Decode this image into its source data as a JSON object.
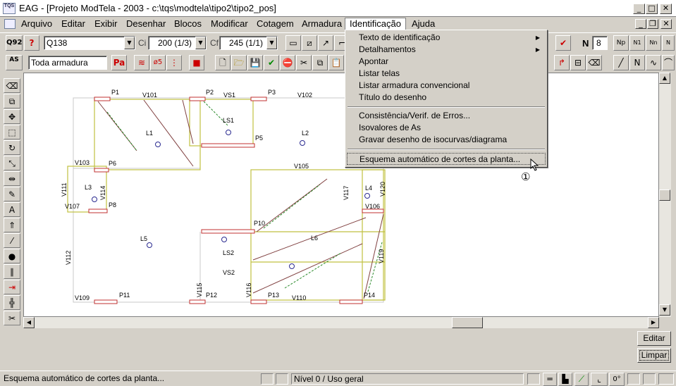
{
  "window": {
    "title": "EAG - [Projeto ModTela - 2003 - c:\\tqs\\modtela\\tipo2\\tipo2_pos]",
    "app_icon": "TQS"
  },
  "menubar": {
    "items": [
      "Arquivo",
      "Editar",
      "Exibir",
      "Desenhar",
      "Blocos",
      "Modificar",
      "Cotagem",
      "Armadura",
      "Identificação",
      "Ajuda"
    ],
    "active": "Identificação"
  },
  "toolbar1": {
    "q92_label": "Q92",
    "bar_combo": "Q138",
    "ci_label": "Ci",
    "ci_value": "200 (1/3)",
    "cf_label": "Cf",
    "cf_value": "245 (1/1)",
    "n_label": "N",
    "n_value": "8"
  },
  "toolbar2": {
    "as_label": "AS",
    "filter_value": "Toda armadura",
    "pa_label": "Pa",
    "o5_label": "ø5"
  },
  "dropdown_menu": {
    "items": [
      {
        "label": "Texto de identificação",
        "submenu": true
      },
      {
        "label": "Detalhamentos",
        "submenu": true
      },
      {
        "label": "Apontar"
      },
      {
        "label": "Listar telas"
      },
      {
        "label": "Listar armadura convencional"
      },
      {
        "label": "Título do desenho"
      },
      {
        "label": "Consistência/Verif. de Erros..."
      },
      {
        "label": "Isovalores de As"
      },
      {
        "label": "Gravar desenho de isocurvas/diagrama"
      },
      {
        "label": "Esquema automático de cortes da planta..."
      }
    ],
    "highlighted": "Esquema automático de cortes da planta...",
    "callout": "①"
  },
  "drawing": {
    "labels": {
      "P1": "P1",
      "P2": "P2",
      "P3": "P3",
      "P5": "P5",
      "P6": "P6",
      "P8": "P8",
      "P10": "P10",
      "P11": "P11",
      "P12": "P12",
      "P13": "P13",
      "P14": "P14",
      "V101": "V101",
      "VS1": "VS1",
      "V102": "V102",
      "V103": "V103",
      "V105": "V105",
      "V106": "V106",
      "V107": "V107",
      "V109": "V109",
      "V110": "V110",
      "V111": "V111",
      "V112": "V112",
      "V114": "V114",
      "V115": "V115",
      "V116": "V116",
      "V117": "V117",
      "V119": "V119",
      "V120": "V120",
      "VS2": "VS2",
      "L1": "L1",
      "L2": "L2",
      "L3": "L3",
      "L4": "L4",
      "L5": "L5",
      "L6": "L6",
      "LS1": "LS1",
      "LS2": "LS2"
    }
  },
  "side_buttons": {
    "edit": "Editar",
    "clear": "Limpar"
  },
  "statusbar": {
    "message": "Esquema automático de cortes da planta...",
    "level": "Nível 0 / Uso geral",
    "angle": "0°"
  }
}
